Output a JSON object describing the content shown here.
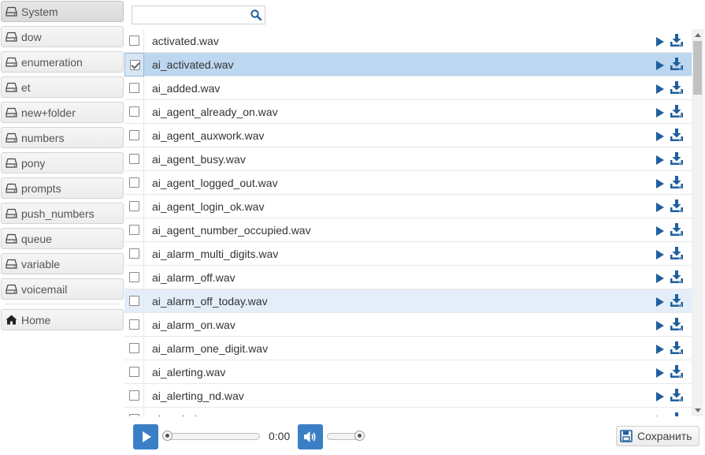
{
  "sidebar": {
    "folders": [
      {
        "label": "System",
        "active": true
      },
      {
        "label": "dow"
      },
      {
        "label": "enumeration"
      },
      {
        "label": "et"
      },
      {
        "label": "new+folder"
      },
      {
        "label": "numbers"
      },
      {
        "label": "pony"
      },
      {
        "label": "prompts"
      },
      {
        "label": "push_numbers"
      },
      {
        "label": "queue"
      },
      {
        "label": "variable"
      },
      {
        "label": "voicemail"
      }
    ],
    "home_label": "Home"
  },
  "search": {
    "value": "",
    "placeholder": ""
  },
  "files": [
    {
      "name": "activated.wav",
      "checked": false
    },
    {
      "name": "ai_activated.wav",
      "checked": true,
      "state": "selected"
    },
    {
      "name": "ai_added.wav",
      "checked": false
    },
    {
      "name": "ai_agent_already_on.wav",
      "checked": false
    },
    {
      "name": "ai_agent_auxwork.wav",
      "checked": false
    },
    {
      "name": "ai_agent_busy.wav",
      "checked": false
    },
    {
      "name": "ai_agent_logged_out.wav",
      "checked": false
    },
    {
      "name": "ai_agent_login_ok.wav",
      "checked": false
    },
    {
      "name": "ai_agent_number_occupied.wav",
      "checked": false
    },
    {
      "name": "ai_alarm_multi_digits.wav",
      "checked": false
    },
    {
      "name": "ai_alarm_off.wav",
      "checked": false
    },
    {
      "name": "ai_alarm_off_today.wav",
      "checked": false,
      "state": "hovered"
    },
    {
      "name": "ai_alarm_on.wav",
      "checked": false
    },
    {
      "name": "ai_alarm_one_digit.wav",
      "checked": false
    },
    {
      "name": "ai_alerting.wav",
      "checked": false
    },
    {
      "name": "ai_alerting_nd.wav",
      "checked": false
    },
    {
      "name": "ai_auth_incorrect.wav",
      "checked": false
    }
  ],
  "player": {
    "time": "0:00",
    "progress": 0,
    "volume": 1.0
  },
  "save_label": "Сохранить",
  "colors": {
    "accent": "#3a7fc6",
    "icon": "#1f5f9e",
    "selected_row": "#bcd7ef",
    "hover_row": "#e3eef8"
  },
  "icons": {
    "folder": "drive-icon",
    "home": "home-icon",
    "search": "search-icon",
    "row_play": "play-icon",
    "row_download": "download-icon",
    "save": "floppy-icon",
    "volume": "volume-icon"
  }
}
